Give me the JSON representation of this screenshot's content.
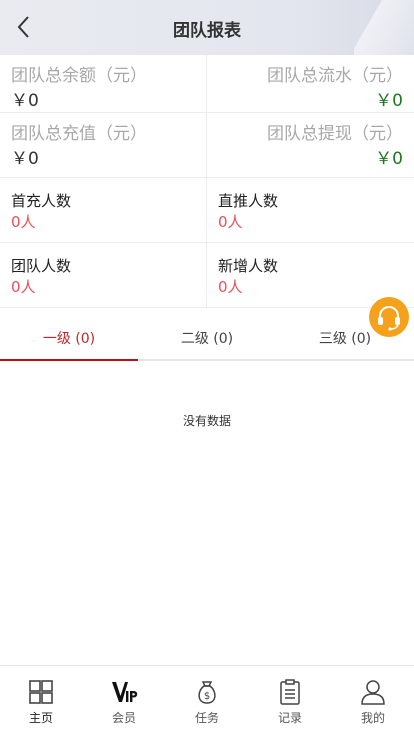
{
  "header": {
    "title": "团队报表"
  },
  "stats": {
    "total_balance": {
      "label": "团队总余额（元）",
      "value": "￥0"
    },
    "total_flow": {
      "label": "团队总流水（元）",
      "value": "￥0"
    },
    "total_recharge": {
      "label": "团队总充值（元）",
      "value": "￥0"
    },
    "total_withdraw": {
      "label": "团队总提现（元）",
      "value": "￥0"
    },
    "first_recharge": {
      "label": "首充人数",
      "value": "0人"
    },
    "direct_push": {
      "label": "直推人数",
      "value": "0人"
    },
    "team_count": {
      "label": "团队人数",
      "value": "0人"
    },
    "new_count": {
      "label": "新增人数",
      "value": "0人"
    }
  },
  "tabs": [
    {
      "label": "一级 (0)",
      "active": true
    },
    {
      "label": "二级 (0)",
      "active": false
    },
    {
      "label": "三级 (0)",
      "active": false
    }
  ],
  "empty_text": "没有数据",
  "nav": [
    {
      "label": "主页",
      "icon": "home-grid-icon",
      "active": true
    },
    {
      "label": "会员",
      "icon": "vip-icon",
      "active": false
    },
    {
      "label": "任务",
      "icon": "money-bag-icon",
      "active": false
    },
    {
      "label": "记录",
      "icon": "clipboard-icon",
      "active": false
    },
    {
      "label": "我的",
      "icon": "user-icon",
      "active": false
    }
  ],
  "colors": {
    "accent": "#c0272d",
    "positive": "#1f7a1f",
    "count": "#e8505b",
    "support": "#f5a11c"
  }
}
